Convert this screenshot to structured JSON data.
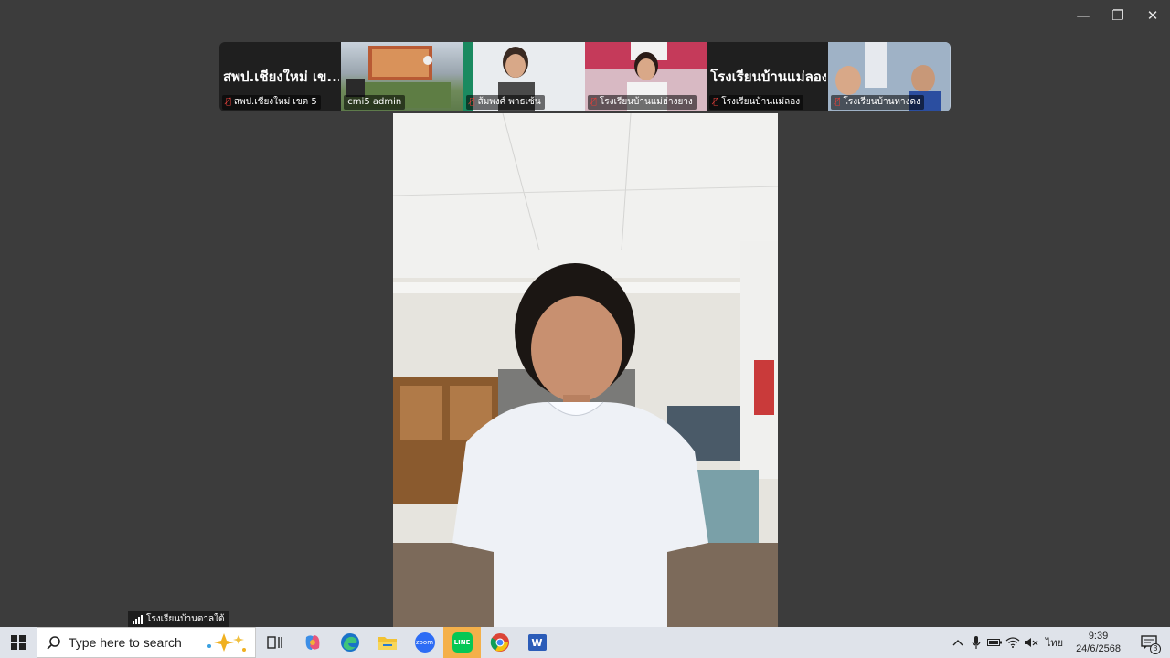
{
  "window": {
    "controls": {
      "minimize": "—",
      "restore": "❐",
      "close": "✕"
    }
  },
  "participants": [
    {
      "big_name": "สพป.เชียงใหม่ เข...",
      "label": "สพป.เชียงใหม่ เขต 5",
      "muted": true
    },
    {
      "big_name": "",
      "label": "cmi5 admin",
      "muted": false
    },
    {
      "big_name": "",
      "label": "ส้มพงศ์ พาธเซ้น",
      "muted": true
    },
    {
      "big_name": "",
      "label": "โรงเรียนบ้านแม่ฮ่างยาง",
      "muted": true
    },
    {
      "big_name": "โรงเรียนบ้านแม่ลอง",
      "label": "โรงเรียนบ้านแม่ลอง",
      "muted": true
    },
    {
      "big_name": "",
      "label": "โรงเรียนบ้านหางดง",
      "muted": true
    }
  ],
  "active_speaker": {
    "label": "โรงเรียนบ้านตาลใต้"
  },
  "taskbar": {
    "search_placeholder": "Type here to search",
    "apps": [
      "copilot-icon",
      "edge-icon",
      "file-explorer-icon",
      "zoom-icon",
      "line-icon",
      "chrome-icon",
      "word-icon"
    ],
    "zoom_label": "zoom",
    "line_label": "LINE",
    "word_label": "W"
  },
  "tray": {
    "language": "ไทย",
    "time": "9:39",
    "date": "24/6/2568",
    "notification_count": "3"
  },
  "colors": {
    "accent": "#f4b04a",
    "mute": "#e0403a",
    "background": "#3c3c3c"
  }
}
